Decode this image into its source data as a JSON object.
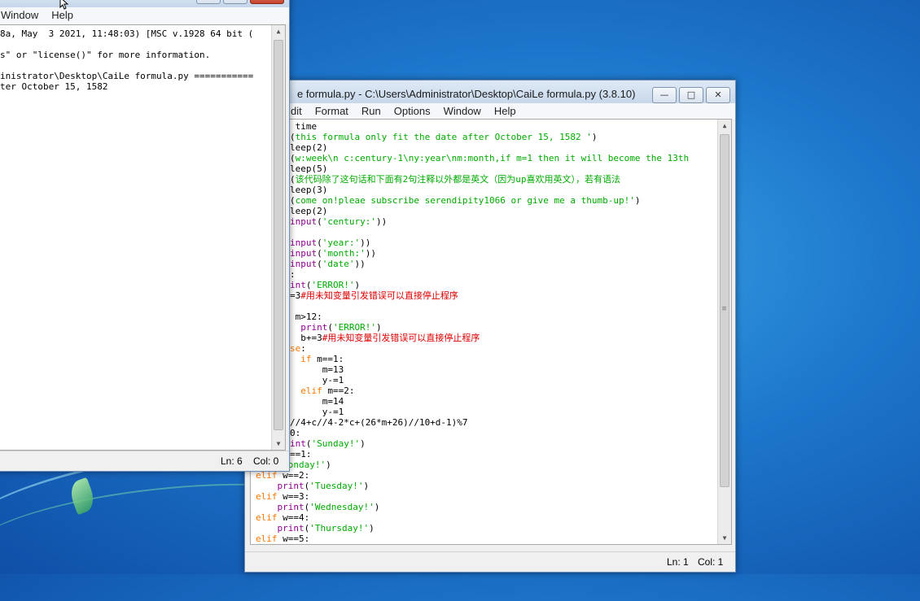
{
  "shell_window": {
    "menu": [
      "Window",
      "Help"
    ],
    "lines": [
      "8a, May  3 2021, 11:48:03) [MSC v.1928 64 bit (",
      "",
      "s\" or \"license()\" for more information.",
      "",
      "inistrator\\Desktop\\CaiLe formula.py ===========",
      "ter October 15, 1582"
    ],
    "status_ln": "Ln: 6",
    "status_col": "Col: 0"
  },
  "editor_window": {
    "title": "e formula.py - C:\\Users\\Administrator\\Desktop\\CaiLe formula.py (3.8.10)",
    "menu": [
      "dit",
      "Format",
      "Run",
      "Options",
      "Window",
      "Help"
    ],
    "status_ln": "Ln: 1",
    "status_col": "Col: 1",
    "code": [
      [
        {
          "t": " time",
          "c": "df"
        }
      ],
      [
        {
          "t": "(",
          "c": "df"
        },
        {
          "t": "this formula only fit the date after October 15, 1582 '",
          "c": "st"
        },
        {
          "t": ")",
          "c": "df"
        }
      ],
      [
        {
          "t": "leep(2)",
          "c": "df"
        }
      ],
      [
        {
          "t": "(",
          "c": "df"
        },
        {
          "t": "w:week\\n c:century-1\\ny:year\\nm:month,if m=1 then it will become the 13th",
          "c": "st"
        }
      ],
      [
        {
          "t": "leep(5)",
          "c": "df"
        }
      ],
      [
        {
          "t": "(",
          "c": "df"
        },
        {
          "t": "该代码除了这句话和下面有2句注释以外都是英文（因为up喜欢用英文），若有语法",
          "c": "st"
        }
      ],
      [
        {
          "t": "leep(3)",
          "c": "df"
        }
      ],
      [
        {
          "t": "(",
          "c": "df"
        },
        {
          "t": "come on!pleae subscribe serendipity1066 or give me a thumb-up!'",
          "c": "st"
        },
        {
          "t": ")",
          "c": "df"
        }
      ],
      [
        {
          "t": "leep(2)",
          "c": "df"
        }
      ],
      [
        {
          "t": "input",
          "c": "bi"
        },
        {
          "t": "(",
          "c": "df"
        },
        {
          "t": "'century:'",
          "c": "st"
        },
        {
          "t": "))",
          "c": "df"
        }
      ],
      [
        {
          "t": "",
          "c": "df"
        }
      ],
      [
        {
          "t": "input",
          "c": "bi"
        },
        {
          "t": "(",
          "c": "df"
        },
        {
          "t": "'year:'",
          "c": "st"
        },
        {
          "t": "))",
          "c": "df"
        }
      ],
      [
        {
          "t": "input",
          "c": "bi"
        },
        {
          "t": "(",
          "c": "df"
        },
        {
          "t": "'month:'",
          "c": "st"
        },
        {
          "t": "))",
          "c": "df"
        }
      ],
      [
        {
          "t": "input",
          "c": "bi"
        },
        {
          "t": "(",
          "c": "df"
        },
        {
          "t": "'date'",
          "c": "st"
        },
        {
          "t": "))",
          "c": "df"
        }
      ],
      [
        {
          "t": ":",
          "c": "df"
        }
      ],
      [
        {
          "t": "int",
          "c": "bi"
        },
        {
          "t": "(",
          "c": "df"
        },
        {
          "t": "'ERROR!'",
          "c": "st"
        },
        {
          "t": ")",
          "c": "df"
        }
      ],
      [
        {
          "t": "=3",
          "c": "df"
        },
        {
          "t": "#用未知变量引发错误可以直接停止程序",
          "c": "cm"
        }
      ],
      [
        {
          "t": "",
          "c": "df"
        }
      ],
      [
        {
          "t": " m>12:",
          "c": "df"
        }
      ],
      [
        {
          "t": "  ",
          "c": "df"
        },
        {
          "t": "print",
          "c": "bi"
        },
        {
          "t": "(",
          "c": "df"
        },
        {
          "t": "'ERROR!'",
          "c": "st"
        },
        {
          "t": ")",
          "c": "df"
        }
      ],
      [
        {
          "t": "  b+=3",
          "c": "df"
        },
        {
          "t": "#用未知变量引发错误可以直接停止程序",
          "c": "cm"
        }
      ],
      [
        {
          "t": "se",
          "c": "kw"
        },
        {
          "t": ":",
          "c": "df"
        }
      ],
      [
        {
          "t": "  ",
          "c": "df"
        },
        {
          "t": "if",
          "c": "kw"
        },
        {
          "t": " m==1:",
          "c": "df"
        }
      ],
      [
        {
          "t": "      m=13",
          "c": "df"
        }
      ],
      [
        {
          "t": "      y-=1",
          "c": "df"
        }
      ],
      [
        {
          "t": "  ",
          "c": "df"
        },
        {
          "t": "elif",
          "c": "kw"
        },
        {
          "t": " m==2:",
          "c": "df"
        }
      ],
      [
        {
          "t": "      m=14",
          "c": "df"
        }
      ],
      [
        {
          "t": "      y-=1",
          "c": "df"
        }
      ],
      [
        {
          "t": "//4+c//4-2*c+(26*m+26)//10+d-1)%7",
          "c": "df"
        }
      ],
      [
        {
          "t": "0:",
          "c": "df"
        }
      ],
      [
        {
          "t": "int",
          "c": "bi"
        },
        {
          "t": "(",
          "c": "df"
        },
        {
          "t": "'Sunday!'",
          "c": "st"
        },
        {
          "t": ")",
          "c": "df"
        }
      ],
      [
        {
          "t": "==1:",
          "c": "df"
        }
      ],
      [
        {
          "t": "int",
          "c": "bi"
        },
        {
          "t": "(",
          "c": "df"
        },
        {
          "t": "'Monday!'",
          "c": "st"
        },
        {
          "t": ")",
          "c": "df"
        }
      ],
      [
        {
          "t": "elif",
          "c": "kw"
        },
        {
          "t": " w==2:",
          "c": "df"
        }
      ],
      [
        {
          "t": "    ",
          "c": "df"
        },
        {
          "t": "print",
          "c": "bi"
        },
        {
          "t": "(",
          "c": "df"
        },
        {
          "t": "'Tuesday!'",
          "c": "st"
        },
        {
          "t": ")",
          "c": "df"
        }
      ],
      [
        {
          "t": "elif",
          "c": "kw"
        },
        {
          "t": " w==3:",
          "c": "df"
        }
      ],
      [
        {
          "t": "    ",
          "c": "df"
        },
        {
          "t": "print",
          "c": "bi"
        },
        {
          "t": "(",
          "c": "df"
        },
        {
          "t": "'Wednesday!'",
          "c": "st"
        },
        {
          "t": ")",
          "c": "df"
        }
      ],
      [
        {
          "t": "elif",
          "c": "kw"
        },
        {
          "t": " w==4:",
          "c": "df"
        }
      ],
      [
        {
          "t": "    ",
          "c": "df"
        },
        {
          "t": "print",
          "c": "bi"
        },
        {
          "t": "(",
          "c": "df"
        },
        {
          "t": "'Thursday!'",
          "c": "st"
        },
        {
          "t": ")",
          "c": "df"
        }
      ],
      [
        {
          "t": "elif",
          "c": "kw"
        },
        {
          "t": " w==5:",
          "c": "df"
        }
      ]
    ]
  }
}
